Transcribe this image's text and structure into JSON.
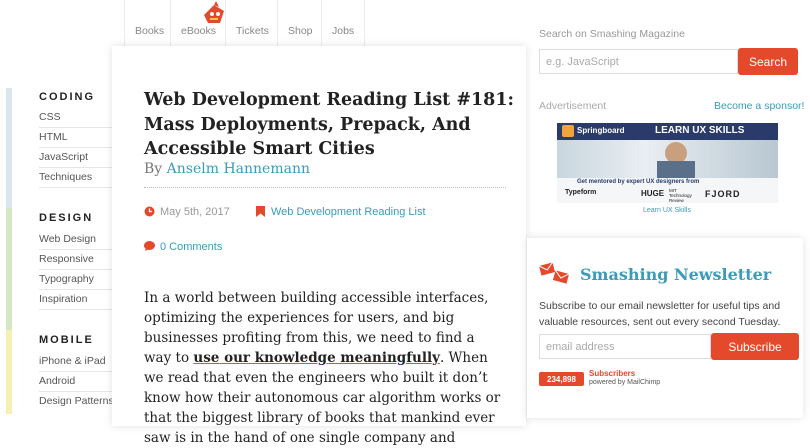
{
  "nav": {
    "items": [
      "Books",
      "eBooks",
      "Tickets",
      "Shop",
      "Jobs"
    ]
  },
  "sidebar": {
    "categories": [
      {
        "title": "CODING",
        "links": [
          "CSS",
          "HTML",
          "JavaScript",
          "Techniques"
        ]
      },
      {
        "title": "DESIGN",
        "links": [
          "Web Design",
          "Responsive",
          "Typography",
          "Inspiration"
        ]
      },
      {
        "title": "MOBILE",
        "links": [
          "iPhone & iPad",
          "Android",
          "Design Patterns"
        ]
      }
    ],
    "strip_colors": [
      "#d9e6ef",
      "#d5e8c4",
      "#f6f1b2"
    ]
  },
  "article": {
    "title": "Web Development Reading List #181: Mass Deployments, Prepack, And Accessible Smart Cities",
    "by": "By",
    "author": "Anselm Hannemann",
    "date": "May 5th, 2017",
    "category": "Web Development Reading List",
    "comments": "0 Comments",
    "body_1": "In a world between building accessible interfaces, optimizing the experiences for users, and big businesses profiting from this, we need to find a way to",
    "body_highlight": "use our knowledge meaningfully",
    "body_2": ". When we read that even the engineers who built it don’t know how their autonomous car algorithm works or that the biggest library of books that mankind ever saw is in the hand of one single company and"
  },
  "search": {
    "label": "Search on Smashing Magazine",
    "placeholder": "e.g. JavaScript",
    "button": "Search"
  },
  "ad": {
    "label": "Advertisement",
    "sponsor_link": "Become a sponsor!",
    "brand": "Springboard",
    "headline": "LEARN UX SKILLS",
    "subline": "Get mentored by expert UX designers from",
    "partners": [
      "Typeform",
      "HUGE",
      "MIT Technology Review",
      "FJORD"
    ],
    "caption": "Learn UX Skills"
  },
  "newsletter": {
    "title": "Smashing Newsletter",
    "description": "Subscribe to our email newsletter for useful tips and valuable resources, sent out every second Tuesday.",
    "placeholder": "email address",
    "button": "Subscribe",
    "subscriber_count": "234,898",
    "subscribers_label": "Subscribers",
    "powered_by": "powered by MailChimp"
  },
  "colors": {
    "accent_red": "#e4492c",
    "link_blue": "#3a9bba"
  }
}
